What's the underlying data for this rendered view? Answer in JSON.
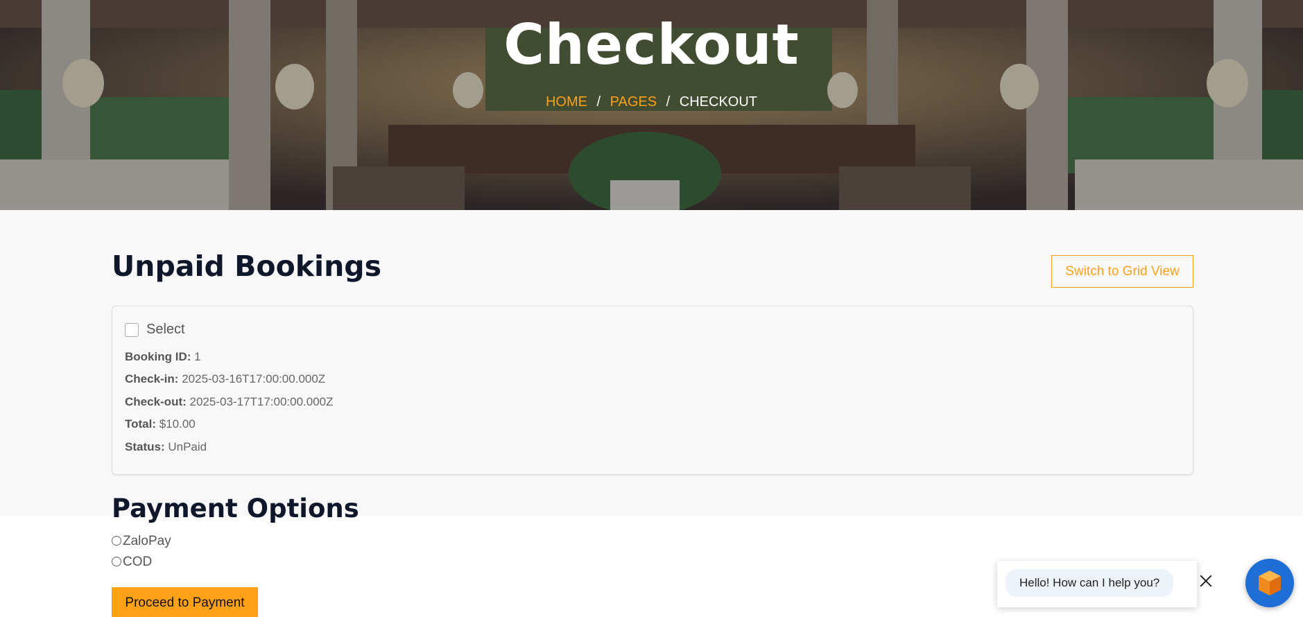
{
  "hero": {
    "title": "Checkout",
    "breadcrumb": {
      "home": "HOME",
      "pages": "PAGES",
      "current": "CHECKOUT",
      "separator": "/"
    }
  },
  "unpaid": {
    "title": "Unpaid Bookings",
    "switch_button": "Switch to Grid View",
    "bookings": [
      {
        "select_label": "Select",
        "booking_id_label": "Booking ID:",
        "booking_id": "1",
        "checkin_label": "Check-in:",
        "checkin": "2025-03-16T17:00:00.000Z",
        "checkout_label": "Check-out:",
        "checkout": "2025-03-17T17:00:00.000Z",
        "total_label": "Total:",
        "total": "$10.00",
        "status_label": "Status:",
        "status": "UnPaid"
      }
    ]
  },
  "payment": {
    "title": "Payment Options",
    "options": [
      "ZaloPay",
      "COD"
    ],
    "proceed_button": "Proceed to Payment"
  },
  "chat": {
    "greeting": "Hello! How can I help you?",
    "close_icon": "close-icon",
    "launcher_icon": "cube-icon"
  },
  "colors": {
    "accent": "#fea116",
    "heading": "#0f172b",
    "chat_fab": "#1e6ed6"
  }
}
